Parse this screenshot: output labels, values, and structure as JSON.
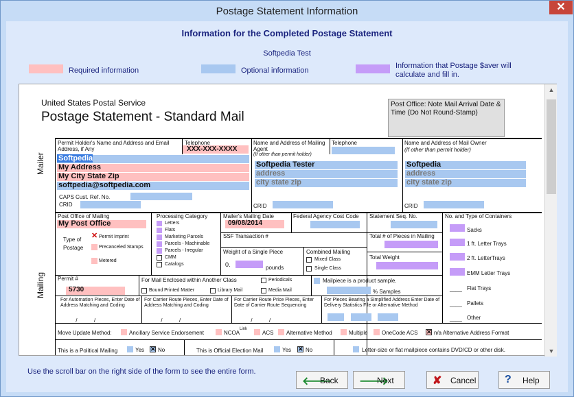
{
  "window": {
    "title": "Postage Statement Information"
  },
  "header": {
    "title": "Information for the Completed Postage Statement",
    "subtitle": "Softpedia Test"
  },
  "legend": {
    "required": "Required information",
    "optional": "Optional information",
    "calc": "Information that Postage $aver will calculate and fill in.",
    "colors": {
      "required": "#ffc0c0",
      "optional": "#a8c8f0",
      "calc": "#c59cf8"
    }
  },
  "form": {
    "usps": "United States Postal Service",
    "title": "Postage Statement - Standard Mail",
    "post_office_note": "Post Office: Note Mail Arrival Date & Time (Do Not Round-Stamp)",
    "mailer_label": "Mailer",
    "mailing_label": "Mailing",
    "permit_holder_label": "Permit Holder's Name and Address and Email Address, if Any",
    "telephone_label": "Telephone",
    "telephone_value": "XXX-XXX-XXXX",
    "holder_lines": [
      "Softpedia",
      "My Address",
      "My City State Zip",
      "softpedia@softpedia.com"
    ],
    "caps_label": "CAPS  Cust. Ref. No.",
    "crid_label": "CRID",
    "agent_label": "Name and Address of Mailing Agent",
    "agent_note": "(If other than permit holder)",
    "agent_telephone": "Telephone",
    "agent_lines": [
      "Softpedia Tester",
      "address",
      "city state zip"
    ],
    "owner_label": "Name and Address of Mail Owner",
    "owner_note": "(If other than permit holder)",
    "owner_lines": [
      "Softpedia",
      "address",
      "city state zip"
    ],
    "po_mailing_label": "Post Office of Mailing",
    "po_mailing_value": "My Post Office",
    "type_postage_label": "Type of Postage",
    "postage_types": [
      "Permit Imprint",
      "Precanceled Stamps",
      "Metered"
    ],
    "processing_label": "Processing Category",
    "processing": [
      "Letters",
      "Flats",
      "Marketing Parcels",
      "Parcels - Machinable",
      "Parcels - Irregular",
      "CMM",
      "Catalogs"
    ],
    "mailing_date_label": "Mailer's Mailing Date",
    "mailing_date_value": "09/08/2014",
    "federal_label": "Federal Agency Cost Code",
    "stmt_seq_label": "Statement Seq. No.",
    "containers_label": "No. and Type of Containers",
    "containers": [
      "Sacks",
      "1 ft. Letter Trays",
      "2 ft. LetterTrays",
      "EMM Letter Trays",
      "Flat Trays",
      "Pallets",
      "Other"
    ],
    "ssf_label": "SSF Transaction #",
    "total_pieces_label": "Total # of Pieces in Mailing",
    "weight_label": "Weight of a Single Piece",
    "weight_value": "0.",
    "pounds_label": "pounds",
    "combined_label": "Combined Mailing",
    "combined_opts": [
      "Mixed Class",
      "Single Class"
    ],
    "total_weight_label": "Total Weight",
    "permit_label": "Permit #",
    "permit_value": "5730",
    "enclosed_label": "For Mail Enclosed within Another Class",
    "enclosed_opts": [
      "Bound Printed Matter",
      "Library Mail",
      "Periodicals",
      "Media Mail"
    ],
    "product_sample": "Mailpiece is a product sample.",
    "samples_label": "% Samples",
    "auto_label": "For Automation Pieces, Enter Date of Address Matching and Coding",
    "carrier_label": "For Carrier Route Pieces, Enter Date of Address Matching and Coding",
    "carrier_seq_label": "For Carrier Route Price Pieces, Enter Date of Carrier Route Sequencing",
    "simplified_label": "For Pieces Bearing a Simplified Address Enter Date of Delivery Statistics File or Alternative Method",
    "date_blank": "__ __ / __ __ / __ __",
    "move_label": "Move Update Method:",
    "move_opts": [
      "Ancillary Service Endorsement",
      "NCOA",
      "ACS",
      "Alternative Method",
      "Multiple",
      "OneCode ACS",
      "n/a Alternative Address Format"
    ],
    "ncoa_sup": "Link",
    "political_label": "This is a Political Mailing",
    "election_label": "This is Official Election Mail",
    "yes": "Yes",
    "no": "No",
    "dvd_label": "Letter-size or flat mailpiece contains DVD/CD or other disk."
  },
  "footer": {
    "note": "Use the scroll bar on the right side of the form to see the entire form.",
    "back": "Back",
    "next": "Next",
    "cancel": "Cancel",
    "help": "Help"
  }
}
